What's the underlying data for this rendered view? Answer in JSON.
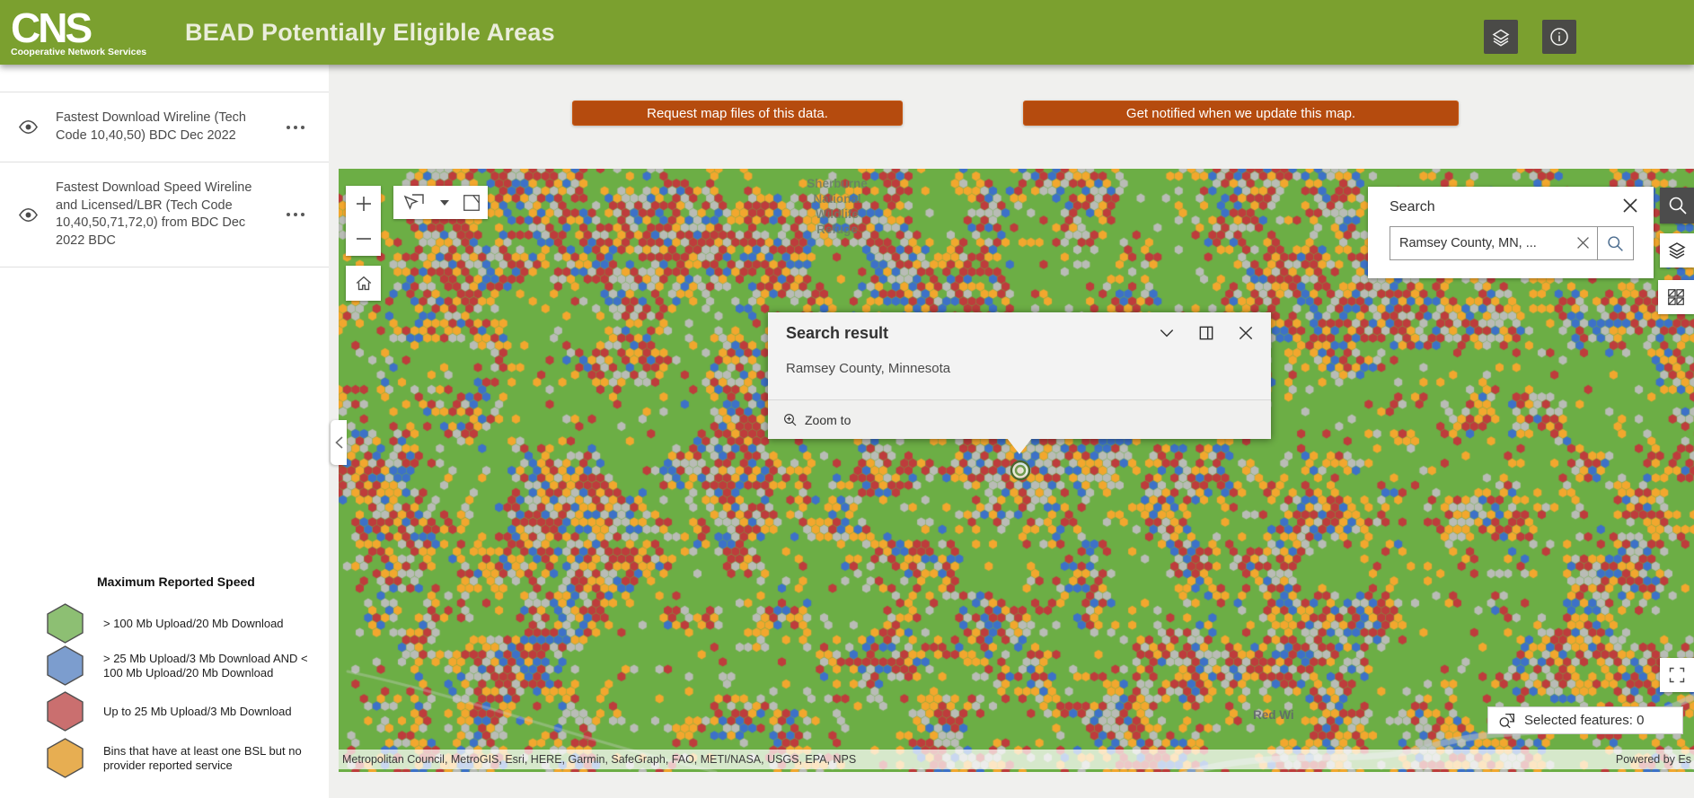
{
  "header": {
    "logo_acronym": "CNS",
    "logo_tagline": "Cooperative Network Services",
    "title": "BEAD Potentially Eligible Areas"
  },
  "actions": {
    "request_button": "Request map files of this data.",
    "notify_button": "Get notified when we update this map."
  },
  "sidebar": {
    "layers": [
      {
        "label": "Fastest Download Wireline (Tech Code 10,40,50) BDC Dec 2022"
      },
      {
        "label": "Fastest Download Speed Wireline and Licensed/LBR (Tech Code 10,40,50,71,72,0) from BDC Dec 2022 BDC"
      }
    ]
  },
  "legend": {
    "title": "Maximum Reported Speed",
    "items": [
      {
        "color": "#8dbf73",
        "label": "> 100 Mb Upload/20 Mb Download"
      },
      {
        "color": "#7c9dce",
        "label": "> 25 Mb Upload/3 Mb Download AND < 100 Mb Upload/20 Mb Download"
      },
      {
        "color": "#ca6f6f",
        "label": "Up to 25 Mb Upload/3 Mb Download"
      },
      {
        "color": "#e7ae52",
        "label": "Bins that have at least one BSL but no provider reported service"
      }
    ]
  },
  "search": {
    "panel_title": "Search",
    "input_value": "Ramsey County, MN, ..."
  },
  "popup": {
    "title": "Search result",
    "result": "Ramsey County, Minnesota",
    "zoom_to_label": "Zoom to"
  },
  "map": {
    "labels": {
      "refuge": "Sherburne\nNational\nWildlife\nRefuge",
      "place": "Red Wi"
    },
    "attribution": "Metropolitan Council, MetroGIS, Esri, HERE, Garmin, SafeGraph, FAO, METI/NASA, USGS, EPA, NPS",
    "powered_by": "Powered by Es",
    "selected_features": "Selected features: 0",
    "palette": {
      "green": "#6cae45",
      "red": "#be3c3c",
      "blue": "#3d71c8",
      "orange": "#f2a72e",
      "gray": "#b9bcb6"
    }
  }
}
